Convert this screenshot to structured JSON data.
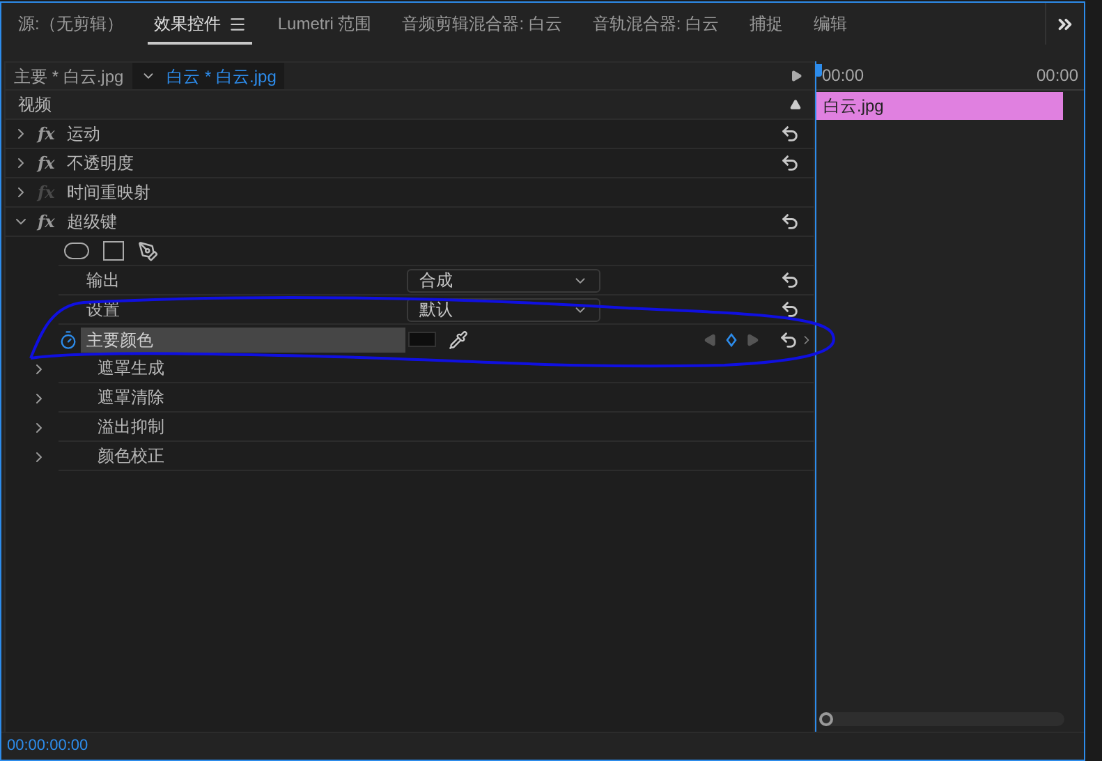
{
  "tabs": [
    {
      "label": "源:（无剪辑）",
      "selected": false,
      "menu": false
    },
    {
      "label": "效果控件",
      "selected": true,
      "menu": true
    },
    {
      "label": "Lumetri 范围",
      "selected": false,
      "menu": false
    },
    {
      "label": "音频剪辑混合器: 白云",
      "selected": false,
      "menu": false
    },
    {
      "label": "音轨混合器: 白云",
      "selected": false,
      "menu": false
    },
    {
      "label": "捕捉",
      "selected": false,
      "menu": false
    },
    {
      "label": "编辑",
      "selected": false,
      "menu": false
    }
  ],
  "clip_tabs": [
    {
      "label": "主要 * 白云.jpg",
      "selected": false
    },
    {
      "label": "白云 * 白云.jpg",
      "selected": true
    }
  ],
  "section": "视频",
  "effects": [
    {
      "name": "运动",
      "badge": "fx",
      "enabled": true,
      "expanded": false,
      "reset": true
    },
    {
      "name": "不透明度",
      "badge": "fx",
      "enabled": true,
      "expanded": false,
      "reset": true
    },
    {
      "name": "时间重映射",
      "badge": "fx",
      "enabled": false,
      "expanded": false,
      "reset": false
    },
    {
      "name": "超级键",
      "badge": "fx",
      "enabled": true,
      "expanded": true,
      "reset": true,
      "children": [
        {
          "kind": "masks"
        },
        {
          "kind": "dropdown",
          "label": "输出",
          "value": "合成"
        },
        {
          "kind": "dropdown",
          "label": "设置",
          "value": "默认"
        },
        {
          "kind": "color",
          "label": "主要颜色",
          "animated": true
        },
        {
          "kind": "group",
          "label": "遮罩生成",
          "expanded": false
        },
        {
          "kind": "group",
          "label": "遮罩清除",
          "expanded": false
        },
        {
          "kind": "group",
          "label": "溢出抑制",
          "expanded": false
        },
        {
          "kind": "group",
          "label": "颜色校正",
          "expanded": false
        }
      ]
    }
  ],
  "timeline": {
    "start": "00:00",
    "end": "00:00",
    "clip": "白云.jpg"
  },
  "timecode": "00:00:00:00"
}
